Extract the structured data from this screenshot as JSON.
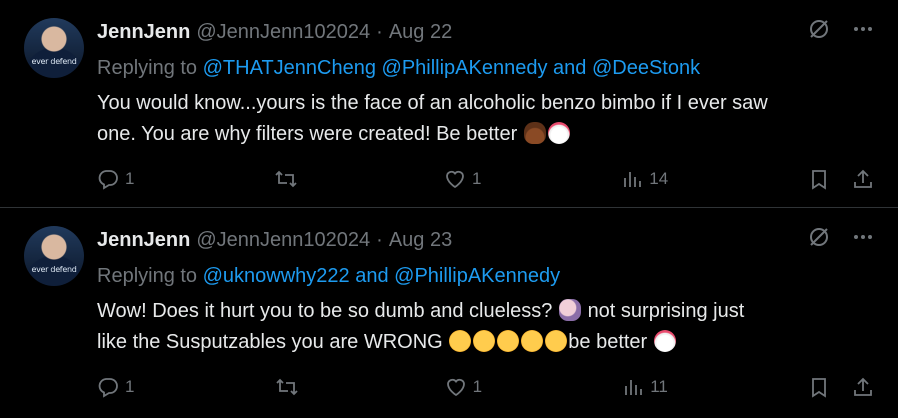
{
  "tweets": [
    {
      "display_name": "JennJenn",
      "handle": "@JennJenn102024",
      "date": "Aug 22",
      "replying_prefix": "Replying to",
      "mentions": "@THATJennCheng @PhillipAKennedy and @DeeStonk",
      "text_line1": "You would know...yours is the face of an alcoholic benzo bimbo if I ever saw",
      "text_line2": "one. You are why filters were created! Be better",
      "replies": "1",
      "retweets": "",
      "likes": "1",
      "views": "14",
      "avatar_caption": "ever defend"
    },
    {
      "display_name": "JennJenn",
      "handle": "@JennJenn102024",
      "date": "Aug 23",
      "replying_prefix": "Replying to",
      "mentions": "@uknowwhy222 and @PhillipAKennedy",
      "text_line1": "Wow! Does it hurt you to be so dumb and clueless?",
      "text_line1_tail": "not surprising just",
      "text_line2": "like the Susputzables you are WRONG",
      "text_line2_tail": "be better",
      "replies": "1",
      "retweets": "",
      "likes": "1",
      "views": "11",
      "avatar_caption": "ever defend"
    }
  ],
  "icons": {
    "grok": "grok-slash-icon",
    "more": "more-dots-icon",
    "reply": "reply-bubble-icon",
    "retweet": "retweet-icon",
    "like": "heart-icon",
    "views": "bar-chart-icon",
    "bookmark": "bookmark-icon",
    "share": "share-upload-icon"
  },
  "colors": {
    "link": "#1d9bf0",
    "muted": "#71767b",
    "text": "#e7e9ea",
    "background": "#000000"
  }
}
